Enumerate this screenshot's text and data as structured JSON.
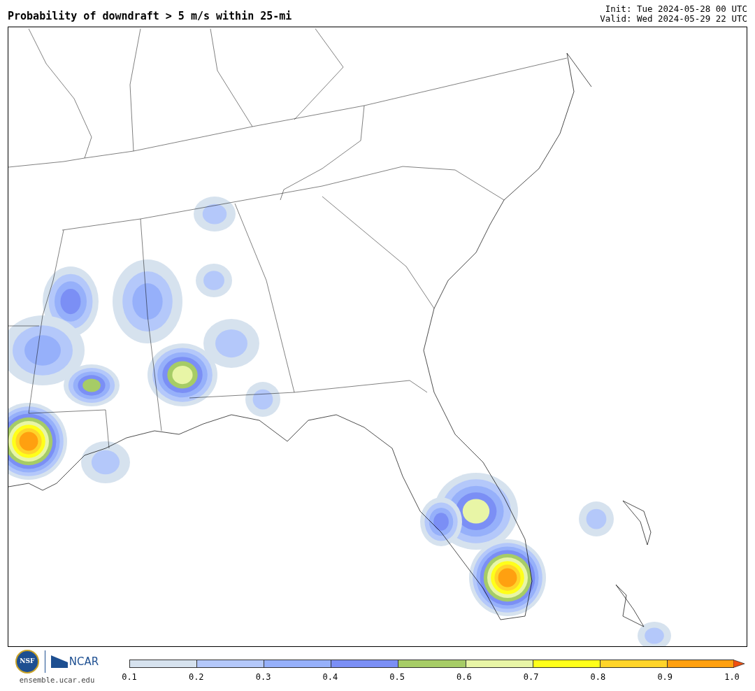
{
  "title": "Probability of downdraft > 5 m/s within 25-mi",
  "init": "Init: Tue 2024-05-28 00 UTC",
  "valid": "Valid: Wed 2024-05-29 22 UTC",
  "logos": {
    "nsf": "NSF",
    "ncar": "NCAR",
    "url": "ensemble.ucar.edu"
  },
  "colorbar": {
    "bins": [
      {
        "color": "#d6e2ee"
      },
      {
        "color": "#b4c8fa"
      },
      {
        "color": "#96b0fa"
      },
      {
        "color": "#7b8ff5"
      },
      {
        "color": "#a6cc66"
      },
      {
        "color": "#e8f5a6"
      },
      {
        "color": "#ffff1a"
      },
      {
        "color": "#ffd42a"
      },
      {
        "color": "#ffa010"
      }
    ],
    "extend": {
      "color": "#f05010"
    },
    "ticks": [
      "0.1",
      "0.2",
      "0.3",
      "0.4",
      "0.5",
      "0.6",
      "0.7",
      "0.8",
      "0.9",
      "1.0"
    ]
  }
}
